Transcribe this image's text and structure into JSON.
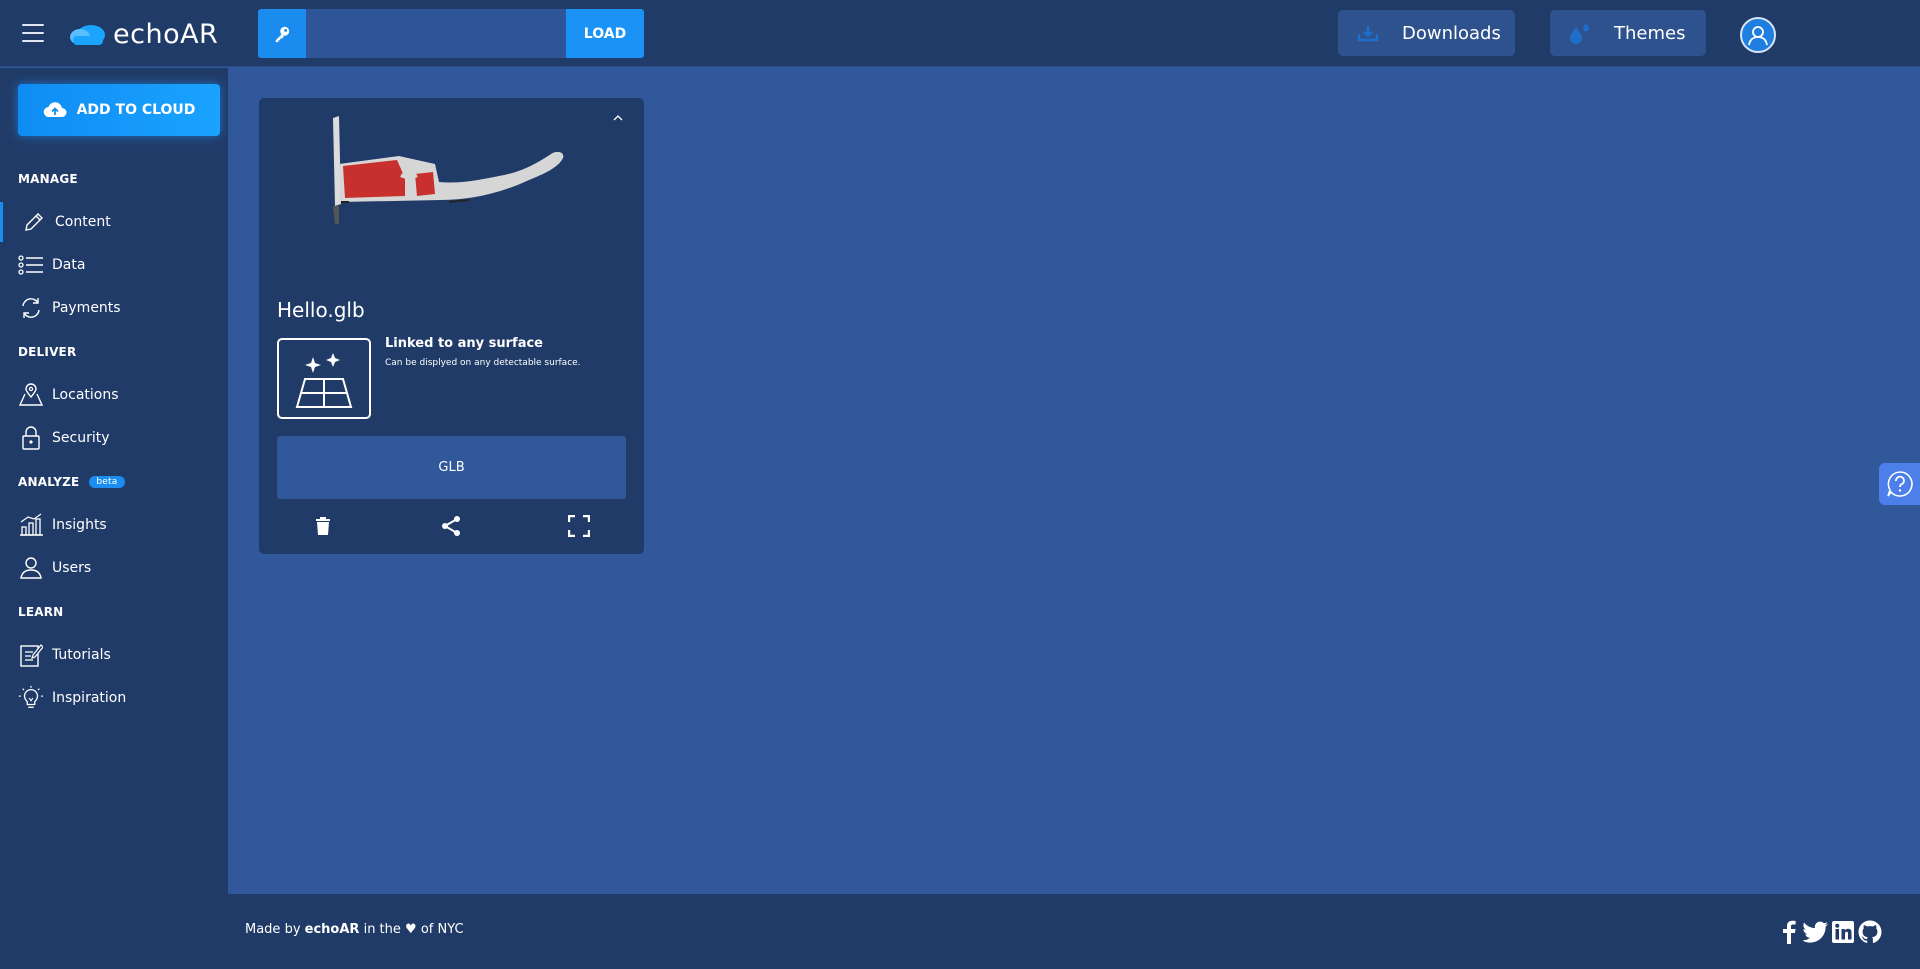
{
  "header": {
    "brand": "echoAR",
    "key_placeholder": "",
    "load_label": "LOAD",
    "downloads_label": "Downloads",
    "themes_label": "Themes"
  },
  "sidebar": {
    "add_to_cloud_label": "ADD TO CLOUD",
    "sections": {
      "manage": "MANAGE",
      "deliver": "DELIVER",
      "analyze": "ANALYZE",
      "analyze_badge": "beta",
      "learn": "LEARN"
    },
    "items": {
      "content": "Content",
      "data": "Data",
      "payments": "Payments",
      "locations": "Locations",
      "security": "Security",
      "insights": "Insights",
      "users": "Users",
      "tutorials": "Tutorials",
      "inspiration": "Inspiration"
    },
    "active_item": "Content"
  },
  "card": {
    "file_name": "Hello.glb",
    "surface_title": "Linked to any surface",
    "surface_desc": "Can be displyed on any detectable surface.",
    "format_label": "GLB"
  },
  "footer": {
    "made_by": "Made by",
    "brand": "echoAR",
    "in_the": "in the",
    "heart": "♥",
    "of_nyc": "of NYC"
  },
  "colors": {
    "header_bg": "#213b68",
    "main_bg": "#30589a",
    "accent": "#1a8cf0"
  }
}
